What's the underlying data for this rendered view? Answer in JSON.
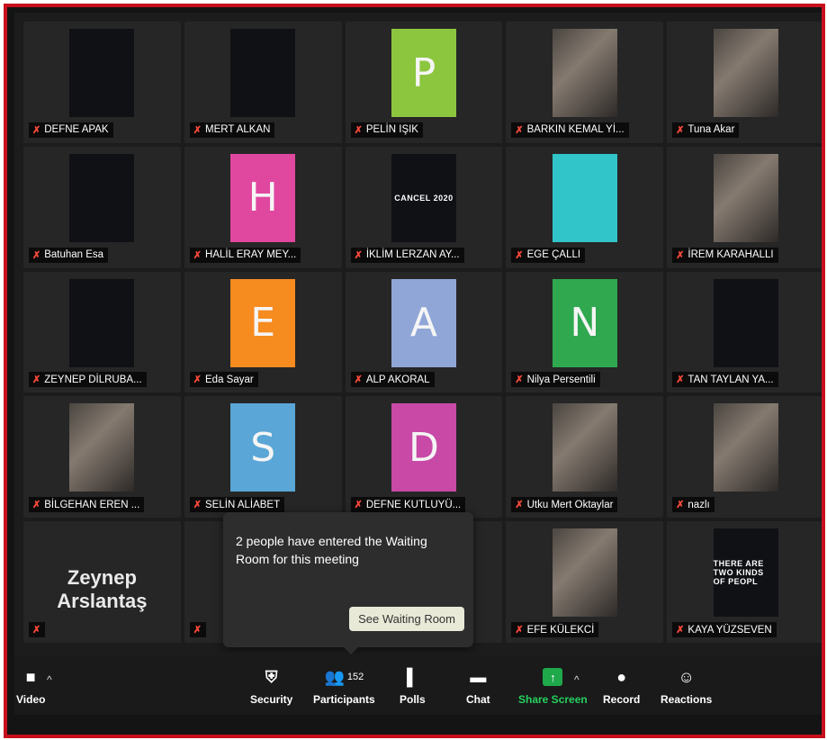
{
  "participants": [
    {
      "name": "DEFNE APAK",
      "kind": "dark"
    },
    {
      "name": "MERT ALKAN",
      "kind": "dark"
    },
    {
      "name": "PELİN IŞIK",
      "kind": "letter",
      "letter": "P",
      "color": "#8cc63f"
    },
    {
      "name": "BARKIN KEMAL Yİ...",
      "kind": "photo"
    },
    {
      "name": "Tuna Akar",
      "kind": "photo"
    },
    {
      "name": "Batuhan Esa",
      "kind": "dark"
    },
    {
      "name": "HALİL ERAY MEY...",
      "kind": "letter",
      "letter": "H",
      "color": "#e0479e"
    },
    {
      "name": "İKLİM LERZAN AY...",
      "kind": "caption",
      "caption": "CANCEL 2020"
    },
    {
      "name": "EGE ÇALLI",
      "kind": "solid",
      "color": "#31c5c9"
    },
    {
      "name": "İREM KARAHALLI",
      "kind": "photo"
    },
    {
      "name": "ZEYNEP DİLRUBA...",
      "kind": "dark"
    },
    {
      "name": "Eda Sayar",
      "kind": "letter",
      "letter": "E",
      "color": "#f68b1f"
    },
    {
      "name": "ALP AKORAL",
      "kind": "letter",
      "letter": "A",
      "color": "#8fa6d6"
    },
    {
      "name": "Nilya Persentili",
      "kind": "letter",
      "letter": "N",
      "color": "#2fa84f"
    },
    {
      "name": "TAN TAYLAN YA...",
      "kind": "dark"
    },
    {
      "name": "BİLGEHAN EREN ...",
      "kind": "photo"
    },
    {
      "name": "SELİN ALİABET",
      "kind": "letter",
      "letter": "S",
      "color": "#5aa6d6"
    },
    {
      "name": "DEFNE KUTLUYÜ...",
      "kind": "letter",
      "letter": "D",
      "color": "#c84aa6"
    },
    {
      "name": "Utku Mert Oktaylar",
      "kind": "photo"
    },
    {
      "name": "nazlı",
      "kind": "photo"
    },
    {
      "name": "",
      "kind": "bigname",
      "big": "Zeynep Arslantaş"
    },
    {
      "name": "",
      "kind": "dark"
    },
    {
      "name": "",
      "kind": "dark"
    },
    {
      "name": "EFE KÜLEKCİ",
      "kind": "photo"
    },
    {
      "name": "KAYA YÜZSEVEN",
      "kind": "caption",
      "caption": "THERE ARE TWO KINDS OF PEOPL"
    }
  ],
  "waiting_room": {
    "message": "2 people have entered the Waiting Room for this meeting",
    "button": "See Waiting Room"
  },
  "toolbar": {
    "video": "Video",
    "security": "Security",
    "participants": "Participants",
    "participants_count": "152",
    "polls": "Polls",
    "chat": "Chat",
    "share": "Share Screen",
    "record": "Record",
    "reactions": "Reactions"
  },
  "icons": {
    "mute": "✗",
    "video": "■",
    "caret": "^",
    "security": "⛨",
    "participants": "👥",
    "polls": "▌",
    "chat": "▬",
    "share_arrow": "↑",
    "record": "●",
    "reactions": "☺"
  },
  "colors": {
    "mute": "#ff4a3a",
    "share": "#25d15e",
    "border": "#c8101d"
  }
}
